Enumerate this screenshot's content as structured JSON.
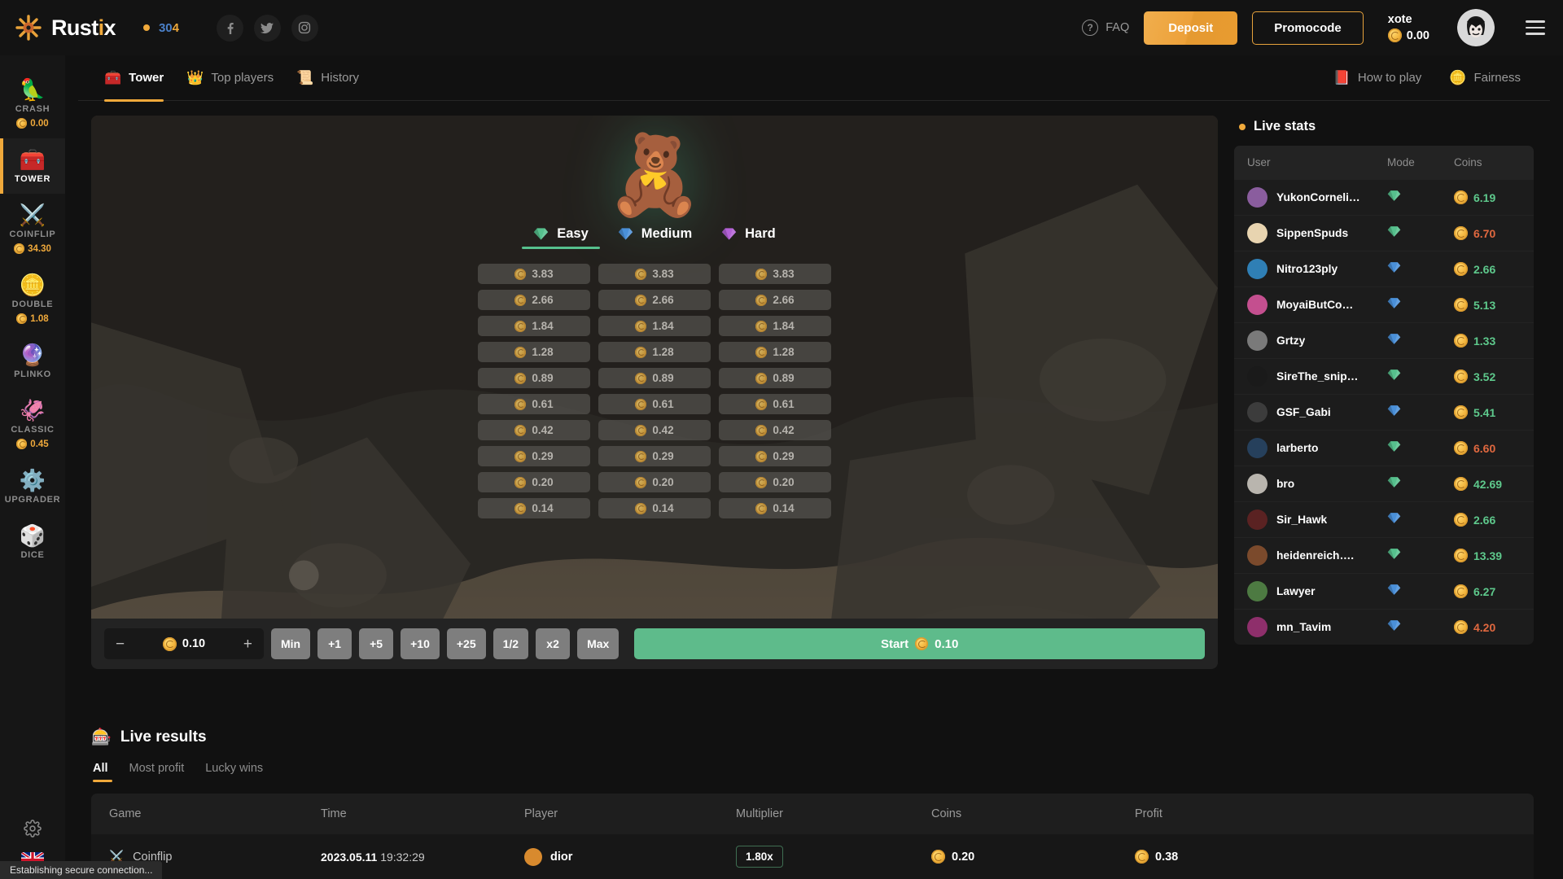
{
  "header": {
    "brand": "Rust",
    "brand_accent": "i",
    "brand_tail": "x",
    "online_count": "30",
    "online_count_tail": "4",
    "socials": [
      {
        "name": "facebook-icon",
        "glyph": "f"
      },
      {
        "name": "twitter-icon",
        "glyph": "t"
      },
      {
        "name": "instagram-icon",
        "glyph": "i"
      }
    ],
    "faq_label": "FAQ",
    "deposit_label": "Deposit",
    "promocode_label": "Promocode",
    "user_name": "xote",
    "user_balance": "0.00",
    "accent_color": "#f0a93b"
  },
  "sidebar": {
    "items": [
      {
        "label": "CRASH",
        "emoji": "🦜",
        "sum": "0.00",
        "active": false
      },
      {
        "label": "TOWER",
        "emoji": "🧰",
        "sum": "",
        "active": true
      },
      {
        "label": "COINFLIP",
        "emoji": "⚔️",
        "sum": "34.30",
        "active": false
      },
      {
        "label": "DOUBLE",
        "emoji": "🪙",
        "sum": "1.08",
        "active": false
      },
      {
        "label": "PLINKO",
        "emoji": "🔮",
        "sum": "",
        "active": false
      },
      {
        "label": "CLASSIC",
        "emoji": "🦑",
        "sum": "0.45",
        "active": false
      },
      {
        "label": "UPGRADER",
        "emoji": "⚙️",
        "sum": "",
        "active": false
      },
      {
        "label": "DICE",
        "emoji": "🎲",
        "sum": "",
        "active": false
      }
    ],
    "settings_icon": "gear-icon",
    "language_flag": "uk-flag"
  },
  "tabs": {
    "left": [
      {
        "label": "Tower",
        "icon": "🧰",
        "active": true
      },
      {
        "label": "Top players",
        "icon": "👑",
        "active": false
      },
      {
        "label": "History",
        "icon": "📜",
        "active": false
      }
    ],
    "right": [
      {
        "label": "How to play",
        "icon": "📕"
      },
      {
        "label": "Fairness",
        "icon": "🪙"
      }
    ]
  },
  "game": {
    "difficulties": [
      {
        "label": "Easy",
        "gem": "💚",
        "color": "#56c08d",
        "active": true
      },
      {
        "label": "Medium",
        "gem": "💙",
        "color": "#4a90d9",
        "active": false
      },
      {
        "label": "Hard",
        "gem": "💜",
        "color": "#b361d6",
        "active": false
      }
    ],
    "rows": [
      "3.83",
      "2.66",
      "1.84",
      "1.28",
      "0.89",
      "0.61",
      "0.42",
      "0.29",
      "0.20",
      "0.14"
    ],
    "columns": 3,
    "bet": {
      "value": "0.10",
      "minus": "−",
      "plus": "+",
      "quick": [
        "Min",
        "+1",
        "+5",
        "+10",
        "+25",
        "1/2",
        "x2",
        "Max"
      ],
      "start_label": "Start",
      "start_amount": "0.10"
    }
  },
  "live_stats": {
    "title": "Live stats",
    "columns": [
      "User",
      "Mode",
      "Coins"
    ],
    "rows": [
      {
        "user": "YukonCorneli…",
        "mode": "easy",
        "coins": "6.19",
        "positive": true,
        "av": "#8a5d9e"
      },
      {
        "user": "SippenSpuds",
        "mode": "easy",
        "coins": "6.70",
        "positive": false,
        "av": "#e8d4b0"
      },
      {
        "user": "Nitro123ply",
        "mode": "medium",
        "coins": "2.66",
        "positive": true,
        "av": "#2f7fb5"
      },
      {
        "user": "MoyaiButCo…",
        "mode": "medium",
        "coins": "5.13",
        "positive": true,
        "av": "#c44f8f"
      },
      {
        "user": "Grtzy",
        "mode": "medium",
        "coins": "1.33",
        "positive": true,
        "av": "#7a7a7a"
      },
      {
        "user": "SireThe_snip…",
        "mode": "easy",
        "coins": "3.52",
        "positive": true,
        "av": "#1a1a1a"
      },
      {
        "user": "GSF_Gabi",
        "mode": "medium",
        "coins": "5.41",
        "positive": true,
        "av": "#3c3c3c"
      },
      {
        "user": "larberto",
        "mode": "easy",
        "coins": "6.60",
        "positive": false,
        "av": "#26405c"
      },
      {
        "user": "bro",
        "mode": "easy",
        "coins": "42.69",
        "positive": true,
        "av": "#b9b5ae"
      },
      {
        "user": "Sir_Hawk",
        "mode": "medium",
        "coins": "2.66",
        "positive": true,
        "av": "#5a2222"
      },
      {
        "user": "heidenreich….",
        "mode": "easy",
        "coins": "13.39",
        "positive": true,
        "av": "#7b4a2c"
      },
      {
        "user": "Lawyer",
        "mode": "medium",
        "coins": "6.27",
        "positive": true,
        "av": "#4d7a42"
      },
      {
        "user": "mn_Tavim",
        "mode": "medium",
        "coins": "4.20",
        "positive": false,
        "av": "#8e2f6b"
      }
    ]
  },
  "live_results": {
    "title": "Live results",
    "icon": "🎰",
    "tabs": [
      {
        "label": "All",
        "active": true
      },
      {
        "label": "Most profit",
        "active": false
      },
      {
        "label": "Lucky wins",
        "active": false
      }
    ],
    "columns": [
      "Game",
      "Time",
      "Player",
      "Multiplier",
      "Coins",
      "Profit"
    ],
    "rows": [
      {
        "game": "Coinflip",
        "game_icon": "⚔️",
        "date": "2023.05.11",
        "time": "19:32:29",
        "player": "dior",
        "player_av": "#d88a2e",
        "multiplier": "1.80x",
        "coins": "0.20",
        "profit": "0.38"
      }
    ]
  },
  "statusbar": {
    "text": "Establishing secure connection..."
  }
}
